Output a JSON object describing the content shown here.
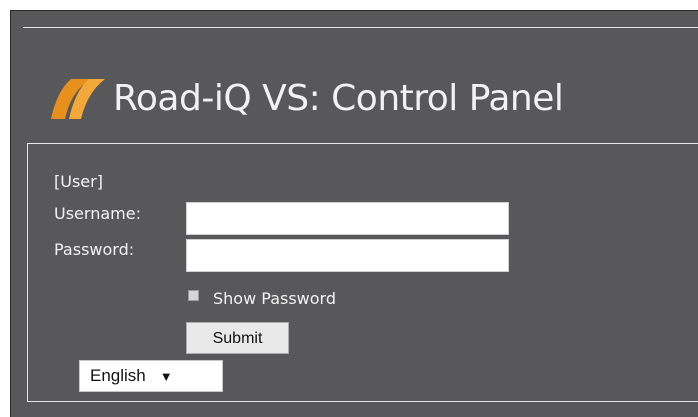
{
  "header": {
    "title": "Road-iQ VS: Control Panel",
    "logo_icon": "road-iq-logo-icon",
    "logo_color": "#e8901e"
  },
  "login": {
    "section_label": "[User]",
    "username_label": "Username:",
    "username_value": "",
    "password_label": "Password:",
    "password_value": "",
    "show_password_label": "Show Password",
    "show_password_checked": false,
    "submit_label": "Submit",
    "language": {
      "selected": "English",
      "arrow": "▼"
    }
  },
  "colors": {
    "background": "#58585a",
    "text": "#f2f2f2",
    "border": "#e6e6e6"
  }
}
